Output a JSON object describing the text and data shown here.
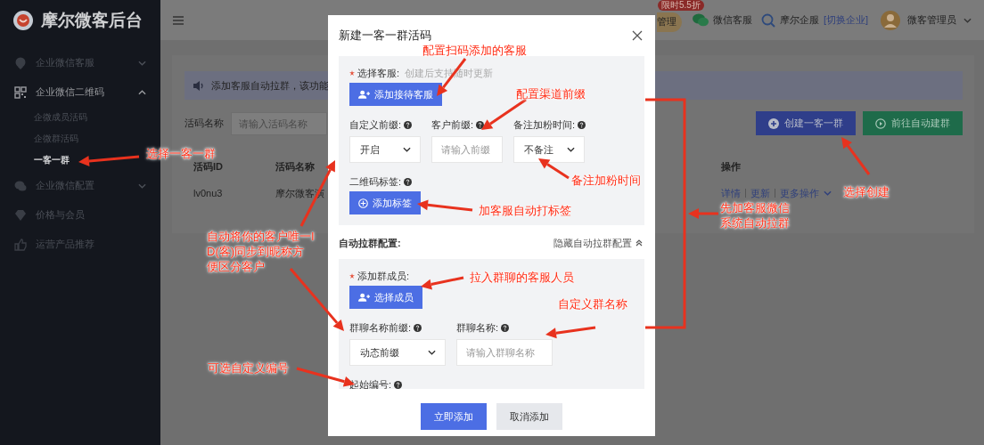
{
  "sidebar": {
    "title": "摩尔微客后台",
    "items": [
      {
        "label": "企业微信客服",
        "expanded": false,
        "selected": false
      },
      {
        "label": "企业微信二维码",
        "expanded": true,
        "selected": false,
        "children": [
          {
            "label": "企微成员活码",
            "selected": false
          },
          {
            "label": "企微群活码",
            "selected": false
          },
          {
            "label": "一客一群",
            "selected": true
          }
        ]
      },
      {
        "label": "企业微信配置",
        "expanded": false,
        "selected": false
      },
      {
        "label": "价格与会员",
        "selected": false
      },
      {
        "label": "运营产品推荐",
        "selected": false
      }
    ]
  },
  "header": {
    "plan": "管理",
    "badge": "限时5.5折",
    "links": [
      {
        "label": "微信客服"
      },
      {
        "label": "摩尔企服",
        "action": "[切换企业]"
      }
    ],
    "user": "微客管理员"
  },
  "content": {
    "notice": "添加客服自动拉群，该功能",
    "search": {
      "label": "活码名称",
      "placeholder": "请输入活码名称"
    },
    "buttons": [
      {
        "label": "创建一客一群",
        "kind": "primary"
      },
      {
        "label": "前往自动建群",
        "kind": "success"
      }
    ],
    "table": {
      "columns": [
        "活码ID",
        "活码名称",
        "操作"
      ],
      "rows": [
        {
          "cells": [
            "lv0nu3",
            "摩尔微客演"
          ],
          "actions": [
            "详情",
            "更新",
            "更多操作"
          ]
        }
      ]
    }
  },
  "modal": {
    "title": "新建一客一群活码",
    "service": {
      "label": "选择客服:",
      "required": true,
      "hint": "创建后支持随时更新",
      "button": "添加接待客服"
    },
    "fields": [
      {
        "kind": "select",
        "label": "自定义前缀:",
        "value": "开启"
      },
      {
        "kind": "input",
        "label": "客户前缀:",
        "placeholder": "请输入前缀"
      },
      {
        "kind": "select",
        "label": "备注加粉时间:",
        "value": "不备注"
      }
    ],
    "tags": {
      "label": "二维码标签:",
      "button": "添加标签"
    },
    "auto_group": {
      "title": "自动拉群配置:",
      "toggle": "隐藏自动拉群配置",
      "expanded": true,
      "members": {
        "label": "添加群成员:",
        "required": true,
        "button": "选择成员"
      },
      "fields": [
        {
          "kind": "select",
          "label": "群聊名称前缀:",
          "value": "动态前缀"
        },
        {
          "kind": "input",
          "label": "群聊名称:",
          "placeholder": "请输入群聊名称"
        }
      ],
      "start_number": {
        "label": "起始编号:"
      }
    },
    "buttons": [
      {
        "label": "立即添加",
        "kind": "primary"
      },
      {
        "label": "取消添加",
        "kind": "secondary"
      }
    ]
  },
  "annotations": [
    {
      "text": "配置扫码添加的客服"
    },
    {
      "text": "配置渠道前缀"
    },
    {
      "text": "备注加粉时间"
    },
    {
      "text": "加客服自动打标签"
    },
    {
      "text": "拉入群聊的客服人员"
    },
    {
      "text": "自定义群名称"
    },
    {
      "text": "选择一客一群"
    },
    {
      "text": "自动将你的客户唯一ID(客)同步到昵称方便区分客户"
    },
    {
      "text": "可选自定义编号"
    },
    {
      "text": "选择创建"
    },
    {
      "text": "先加客服微信系统自动拉群"
    }
  ]
}
